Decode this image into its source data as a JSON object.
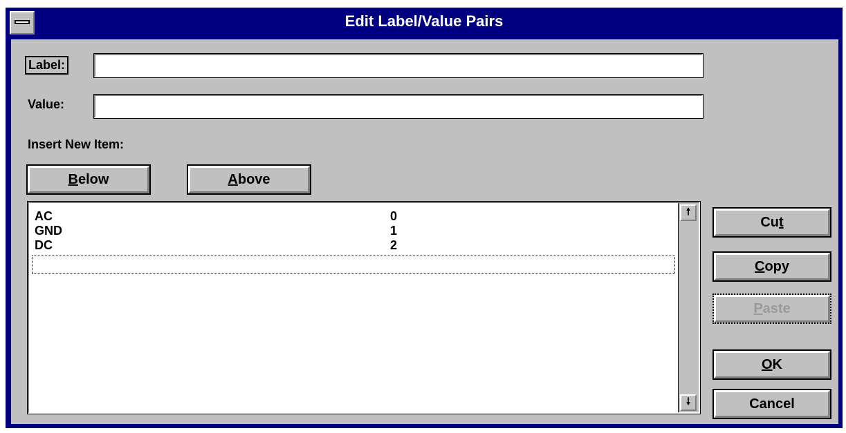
{
  "window": {
    "title": "Edit Label/Value Pairs"
  },
  "form": {
    "label_caption": "Label:",
    "label_value": "",
    "value_caption": "Value:",
    "value_value": "",
    "insert_caption": "Insert New Item:"
  },
  "buttons": {
    "below": {
      "prefix": "",
      "accel": "B",
      "suffix": "elow"
    },
    "above": {
      "prefix": "",
      "accel": "A",
      "suffix": "bove"
    },
    "cut": {
      "prefix": "Cu",
      "accel": "t",
      "suffix": ""
    },
    "copy": {
      "prefix": "",
      "accel": "C",
      "suffix": "opy"
    },
    "paste": {
      "prefix": "",
      "accel": "P",
      "suffix": "aste",
      "disabled": true
    },
    "ok": {
      "prefix": "",
      "accel": "O",
      "suffix": "K"
    },
    "cancel": {
      "prefix": "Cancel",
      "accel": "",
      "suffix": ""
    }
  },
  "list": {
    "rows": [
      {
        "label": "AC",
        "value": "0"
      },
      {
        "label": "GND",
        "value": "1"
      },
      {
        "label": "DC",
        "value": "2"
      }
    ],
    "scroll_up_icon": "arrow-up-icon",
    "scroll_down_icon": "arrow-down-icon"
  }
}
